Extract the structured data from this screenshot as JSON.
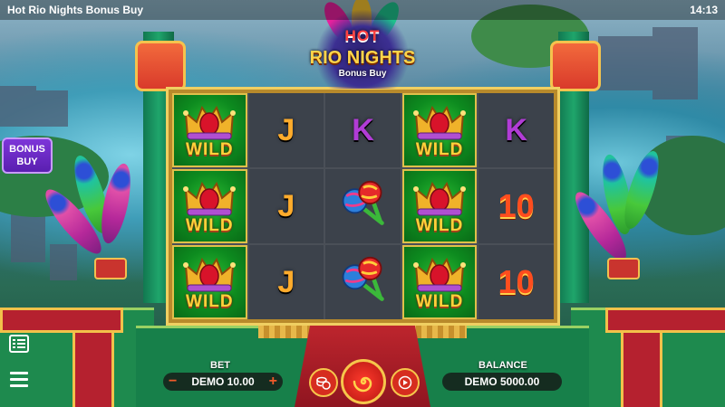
{
  "status_bar": {
    "title": "Hot Rio Nights Bonus Buy",
    "time": "14:13"
  },
  "logo": {
    "line1": "HOT",
    "line2": "RIO NIGHTS",
    "line3": "Bonus Buy"
  },
  "bonus_button": {
    "line1": "BONUS",
    "line2": "BUY"
  },
  "reels": [
    [
      "WILD",
      "J",
      "K",
      "WILD",
      "K"
    ],
    [
      "WILD",
      "J",
      "MARACAS",
      "WILD",
      "10"
    ],
    [
      "WILD",
      "J",
      "MARACAS",
      "WILD",
      "10"
    ]
  ],
  "controls": {
    "bet_label": "BET",
    "bet_value": "DEMO 10.00",
    "minus": "−",
    "plus": "+",
    "balance_label": "BALANCE",
    "balance_value": "DEMO 5000.00"
  },
  "icons": {
    "paytable": "paytable-icon",
    "menu": "hamburger-menu-icon",
    "autoplay": "autoplay-coins-icon",
    "spin": "spin-swirl-icon",
    "turbo": "turbo-play-icon",
    "wild": "crown-icon",
    "maracas": "maracas-icon"
  },
  "colors": {
    "accent_gold": "#f0cf62",
    "spin_button": "#e52b22",
    "bonus_purple": "#6a2bc4",
    "wild_green": "#1aa42a"
  }
}
